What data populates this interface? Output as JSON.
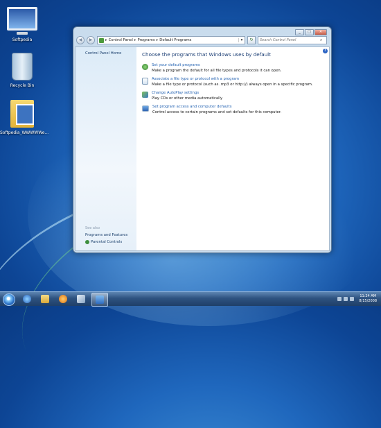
{
  "desktop": {
    "icons": [
      {
        "label": "Softpedia"
      },
      {
        "label": "Recycle Bin"
      },
      {
        "label": "Softpedia_WWWWWe..."
      }
    ]
  },
  "window": {
    "address": {
      "segments": [
        "Control Panel",
        "Programs",
        "Default Programs"
      ],
      "separator": "▸"
    },
    "search": {
      "placeholder": "Search Control Panel"
    },
    "sidebar": {
      "home": "Control Panel Home",
      "see_also": "See also",
      "links": [
        "Programs and Features",
        "Parental Controls"
      ]
    },
    "main": {
      "heading": "Choose the programs that Windows uses by default",
      "tasks": [
        {
          "title": "Set your default programs",
          "desc": "Make a program the default for all file types and protocols it can open.",
          "icon": "default-programs-icon"
        },
        {
          "title": "Associate a file type or protocol with a program",
          "desc": "Make a file type or protocol (such as .mp3 or http://) always open in a specific program.",
          "icon": "file-association-icon"
        },
        {
          "title": "Change AutoPlay settings",
          "desc": "Play CDs or other media automatically",
          "icon": "autoplay-icon"
        },
        {
          "title": "Set program access and computer defaults",
          "desc": "Control access to certain programs and set defaults for this computer.",
          "icon": "program-access-icon"
        }
      ]
    }
  },
  "taskbar": {
    "clock": {
      "time": "11:24 AM",
      "date": "8/15/2008"
    }
  }
}
